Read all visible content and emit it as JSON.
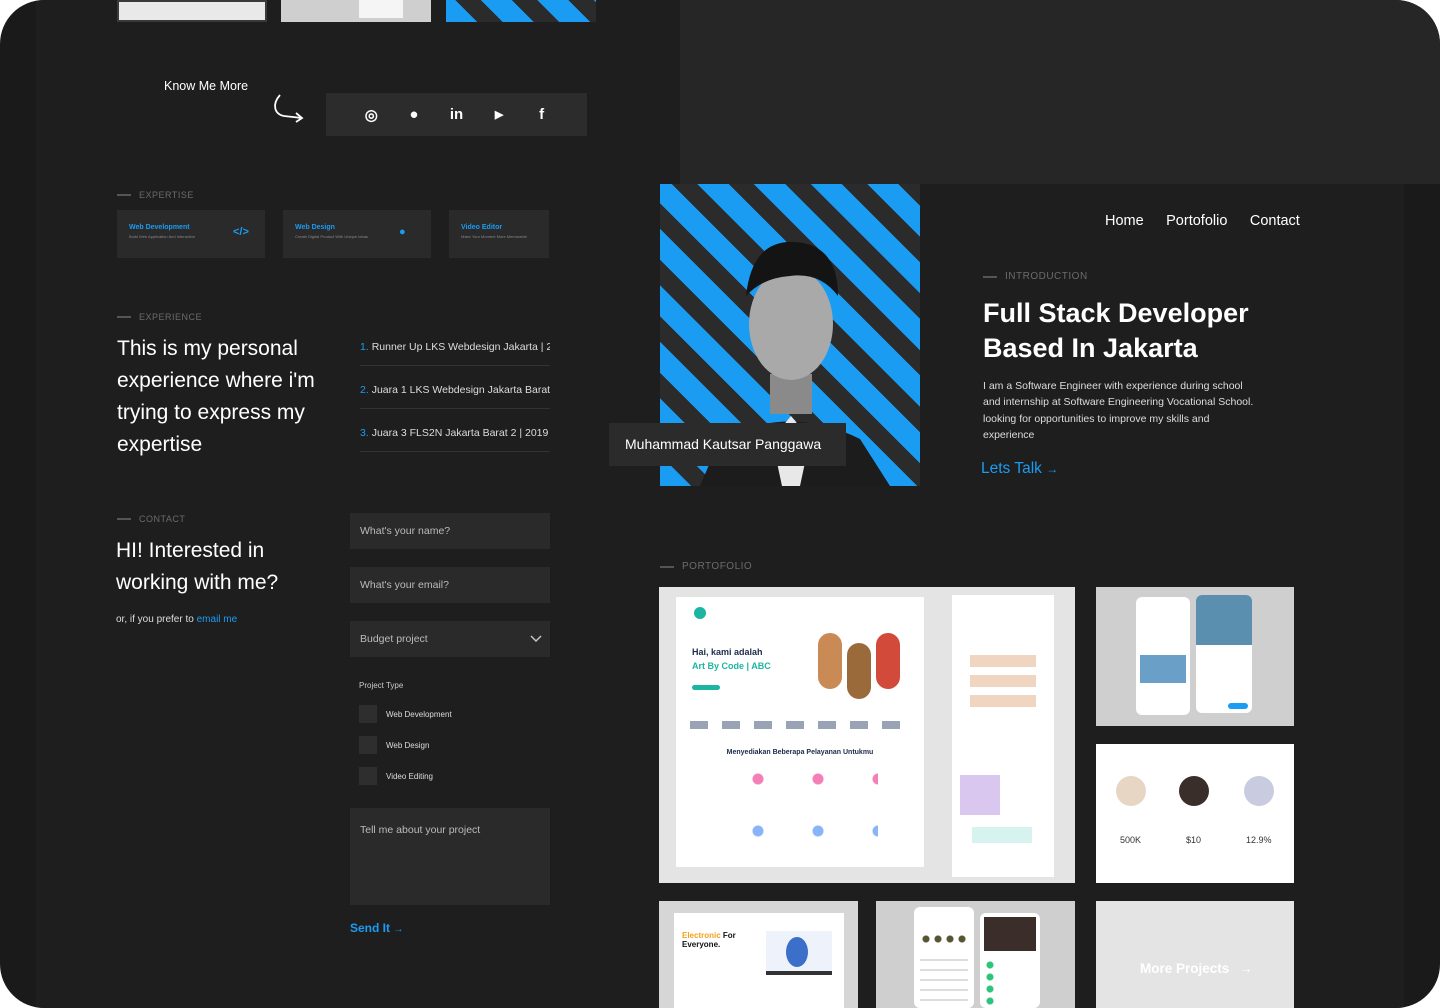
{
  "know_me": {
    "label": "Know Me More"
  },
  "social": {
    "icons": [
      "instagram-icon",
      "github-icon",
      "linkedin-icon",
      "youtube-icon",
      "facebook-icon"
    ],
    "glyphs": [
      "◎",
      "●",
      "in",
      "▶",
      "f"
    ]
  },
  "expertise": {
    "label": "EXPERTISE",
    "cards": [
      {
        "title": "Web Development",
        "subtitle": "Build Web Application And Interactive",
        "icon": "code-icon"
      },
      {
        "title": "Web Design",
        "subtitle": "Create Digital Product With Unique Ideas",
        "icon": "palette-icon"
      },
      {
        "title": "Video Editor",
        "subtitle": "Make Your Moment More Memorable",
        "icon": ""
      }
    ]
  },
  "experience": {
    "label": "EXPERIENCE",
    "heading": "This is my personal experience where i'm trying to express my expertise",
    "items": [
      {
        "num": "1.",
        "text": "Runner Up LKS Webdesign Jakarta | 2"
      },
      {
        "num": "2.",
        "text": "Juara 1 LKS Webdesign Jakarta Barat"
      },
      {
        "num": "3.",
        "text": "Juara 3 FLS2N Jakarta Barat 2 | 2019"
      }
    ]
  },
  "contact": {
    "label": "CONTACT",
    "heading": "HI! Interested in working with me?",
    "prefer_text": "or, if you prefer to ",
    "email_link": "email me",
    "name_placeholder": "What's your name?",
    "email_placeholder": "What's your email?",
    "budget_label": "Budget project",
    "project_type_label": "Project Type",
    "project_types": [
      "Web Development",
      "Web Design",
      "Video Editing"
    ],
    "message_placeholder": "Tell me about your project",
    "send_label": "Send It",
    "send_arrow": "→"
  },
  "nav": {
    "items": [
      "Home",
      "Portofolio",
      "Contact"
    ]
  },
  "hero": {
    "name_tag": "Muhammad Kautsar Panggawa",
    "intro_label": "INTRODUCTION",
    "title_line1": "Full Stack Developer",
    "title_line2": "Based In Jakarta",
    "description": "I am a Software Engineer with  experience during school and internship at  Software Engineering Vocational School. looking for opportunities to improve  my skills and experience",
    "cta_label": "Lets Talk",
    "cta_arrow": "→"
  },
  "portfolio": {
    "label": "PORTOFOLIO",
    "mock1_greeting": "Hai, kami adalah",
    "mock1_brand": "Art By Code | ABC",
    "mock1_services": "Menyediakan Beberapa Pelayanan Untukmu",
    "stats": [
      "500K",
      "$10",
      "12.9%"
    ],
    "mock5_headline_accent": "Electronic",
    "mock5_headline_rest": " For Everyone.",
    "more_label": "More Projects",
    "more_arrow": "→"
  },
  "colors": {
    "accent": "#1a9cf3",
    "background": "#1a1a1a",
    "panel": "#1e1e1e"
  }
}
